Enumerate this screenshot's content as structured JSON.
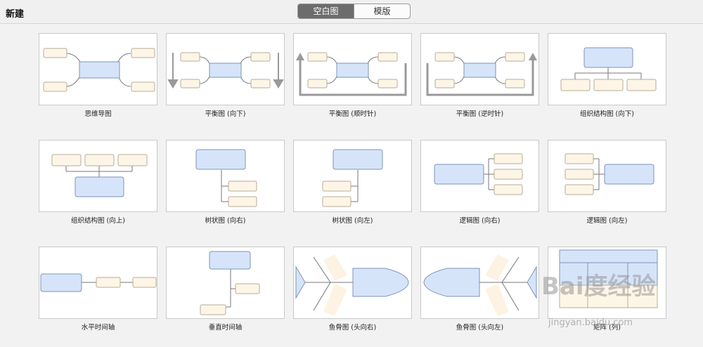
{
  "header": {
    "title": "新建",
    "tabs": [
      {
        "label": "空白图",
        "active": true
      },
      {
        "label": "模版",
        "active": false
      }
    ]
  },
  "templates": [
    {
      "label": "思维导图",
      "icon": "mindmap-diagram-icon"
    },
    {
      "label": "平衡图 (向下)",
      "icon": "balance-down-diagram-icon"
    },
    {
      "label": "平衡图 (顺时针)",
      "icon": "balance-clockwise-diagram-icon"
    },
    {
      "label": "平衡图 (逆时针)",
      "icon": "balance-counterclockwise-diagram-icon"
    },
    {
      "label": "组织结构图 (向下)",
      "icon": "org-chart-down-icon"
    },
    {
      "label": "组织结构图 (向上)",
      "icon": "org-chart-up-icon"
    },
    {
      "label": "树状图 (向右)",
      "icon": "tree-right-icon"
    },
    {
      "label": "树状图 (向左)",
      "icon": "tree-left-icon"
    },
    {
      "label": "逻辑图 (向右)",
      "icon": "logic-right-icon"
    },
    {
      "label": "逻辑图 (向左)",
      "icon": "logic-left-icon"
    },
    {
      "label": "水平时间轴",
      "icon": "horizontal-timeline-icon"
    },
    {
      "label": "垂直时间轴",
      "icon": "vertical-timeline-icon"
    },
    {
      "label": "鱼骨图 (头向右)",
      "icon": "fishbone-right-icon"
    },
    {
      "label": "鱼骨图 (头向左)",
      "icon": "fishbone-left-icon"
    },
    {
      "label": "矩阵 (列)",
      "icon": "matrix-column-icon"
    }
  ],
  "watermark": {
    "brand": "Bai度经验",
    "url": "jingyan.baidu.com"
  },
  "colors": {
    "node_blue": "#d6e4fa",
    "node_blue_border": "#7f93b6",
    "node_cream": "#fdf6e6",
    "node_cream_border": "#b9ab95"
  }
}
